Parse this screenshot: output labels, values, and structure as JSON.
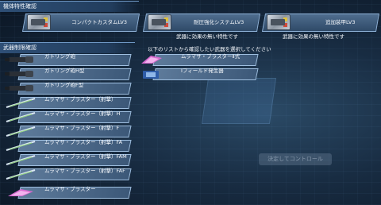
{
  "header_traits": "機体特性確認",
  "header_weapons": "武器制限確認",
  "traits": [
    {
      "name": "コンパクトカスタムLV3",
      "note": ""
    },
    {
      "name": "耐圧強化システムLV3",
      "note": "武器に効果の無い特性です"
    },
    {
      "name": "追加装甲LV3",
      "note": "武器に効果の無い特性です"
    }
  ],
  "instruction": "以下のリストから確認したい武器を選択してください",
  "weapons": [
    {
      "label": "ガトリング砲",
      "icon": "gatling-icon"
    },
    {
      "label": "ガトリング砲H型",
      "icon": "gatling-icon"
    },
    {
      "label": "ガトリング砲F型",
      "icon": "gatling-icon"
    },
    {
      "label": "ムラマサ・ブラスター（射撃）",
      "icon": "sword-icon"
    },
    {
      "label": "ムラマサ・ブラスター（射撃）H",
      "icon": "sword-icon"
    },
    {
      "label": "ムラマサ・ブラスター（射撃）F",
      "icon": "sword-icon"
    },
    {
      "label": "ムラマサ・ブラスター（射撃）FA",
      "icon": "sword-icon"
    },
    {
      "label": "ムラマサ・ブラスター（射撃）FAM",
      "icon": "sword-icon"
    },
    {
      "label": "ムラマサ・ブラスター（射撃）FAF",
      "icon": "sword-icon"
    },
    {
      "label": "ムラマサ・ブラスター",
      "icon": "pink-blade-icon"
    }
  ],
  "selected_weapons": [
    {
      "label": "ムラマサ・ブラスターⅡ式",
      "icon": "pink-blade-icon"
    },
    {
      "label": "Iフィールド発生器",
      "icon": "field-generator-icon"
    }
  ],
  "background_button": "決定してコントロール"
}
